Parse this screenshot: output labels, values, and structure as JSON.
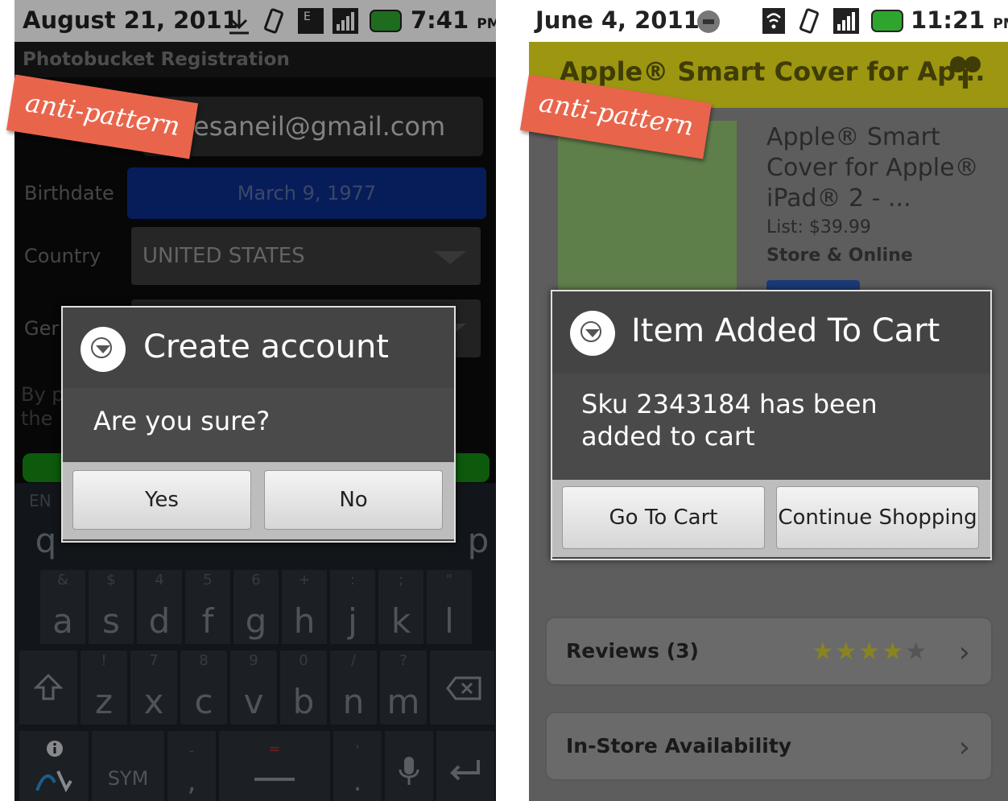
{
  "left_screen": {
    "statusbar": {
      "date": "August 21, 2011",
      "time": "7:41",
      "ampm": "PM"
    },
    "title": "Photobucket Registration",
    "ribbon": "anti-pattern",
    "form": {
      "email_value": "esaneil@gmail.com",
      "birthdate_label": "Birthdate",
      "birthdate_value": "March 9, 1977",
      "country_label": "Country",
      "country_value": "UNITED STATES",
      "gender_label": "Ger",
      "terms_line1": "By p",
      "terms_line2": "the"
    },
    "dialog": {
      "title": "Create account",
      "message": "Are you sure?",
      "yes": "Yes",
      "no": "No"
    },
    "keyboard": {
      "lang": "EN",
      "row1_visible": [
        "q",
        "p"
      ],
      "row2": [
        {
          "ch": "a",
          "sub": "&"
        },
        {
          "ch": "s",
          "sub": "$"
        },
        {
          "ch": "d",
          "sub": "4"
        },
        {
          "ch": "f",
          "sub": "5"
        },
        {
          "ch": "g",
          "sub": "6"
        },
        {
          "ch": "h",
          "sub": "+"
        },
        {
          "ch": "j",
          "sub": ":"
        },
        {
          "ch": "k",
          "sub": ";"
        },
        {
          "ch": "l",
          "sub": "\""
        }
      ],
      "row3": [
        {
          "ch": "z",
          "sub": "!"
        },
        {
          "ch": "x",
          "sub": "7"
        },
        {
          "ch": "c",
          "sub": "8"
        },
        {
          "ch": "v",
          "sub": "9"
        },
        {
          "ch": "b",
          "sub": "0"
        },
        {
          "ch": "n",
          "sub": "/"
        },
        {
          "ch": "m",
          "sub": "?"
        }
      ],
      "sym": "SYM",
      "comma": ",",
      "period": "."
    }
  },
  "right_screen": {
    "statusbar": {
      "date": "June 4, 2011",
      "time": "11:21",
      "ampm": "PM"
    },
    "product_bar_title": "Apple® Smart Cover for Ap...",
    "ribbon": "anti-pattern",
    "product": {
      "name": "Apple® Smart Cover for Apple® iPad® 2 - ...",
      "list_price": "List: $39.99",
      "availability": "Store & Online"
    },
    "dialog": {
      "title": "Item Added To Cart",
      "message": "Sku 2343184 has been added to cart",
      "go_to_cart": "Go To Cart",
      "continue": "Continue Shopping"
    },
    "reviews_label": "Reviews (3)",
    "rating_stars": 4,
    "instore_label": "In-Store Availability"
  }
}
